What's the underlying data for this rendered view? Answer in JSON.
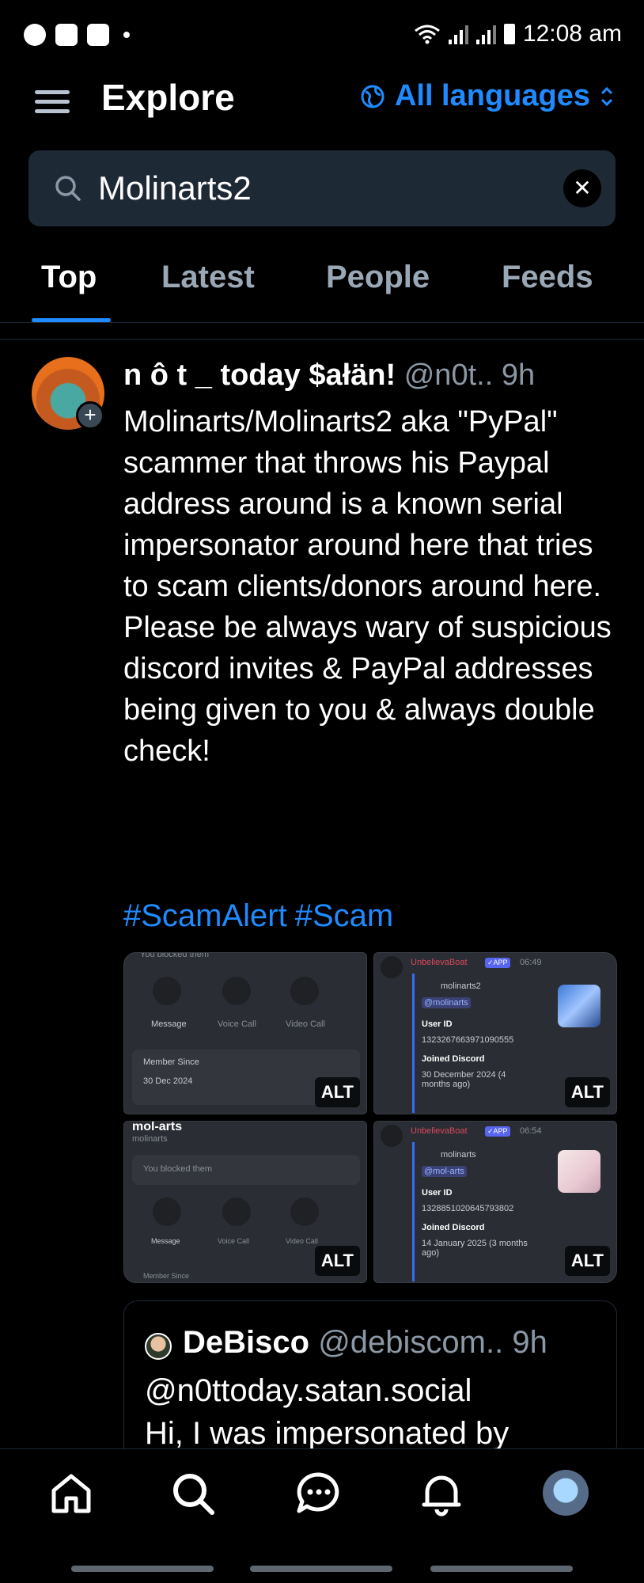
{
  "status_bar": {
    "time": "12:08 am",
    "icons": [
      "messenger-icon",
      "gallery-icon",
      "discord-icon",
      "dot-icon",
      "wifi-icon",
      "signal-icon",
      "signal-icon",
      "battery-icon"
    ]
  },
  "header": {
    "title": "Explore",
    "language": "All languages"
  },
  "search": {
    "value": "Molinarts2"
  },
  "tabs": [
    "Top",
    "Latest",
    "People",
    "Feeds"
  ],
  "active_tab": "Top",
  "post": {
    "display_name": "n ô t _ today $ałän!",
    "handle": "@n0t..",
    "time": "9h",
    "body": "Molinarts/Molinarts2 aka \"PyPal\" scammer that throws his Paypal address around is a known serial impersonator around here that tries to scam clients/donors around here. Please be always wary of suspicious discord invites & PayPal addresses being given to you & always double check!",
    "hashtags": [
      "#ScamAlert",
      "#Scam"
    ],
    "images": [
      {
        "alt_label": "ALT",
        "top_text": "You blocked them",
        "actions": [
          "Message",
          "Voice Call",
          "Video Call"
        ],
        "member_since_label": "Member Since",
        "member_since_value": "30 Dec 2024"
      },
      {
        "alt_label": "ALT",
        "bot_name": "UnbelievaBoat",
        "app_badge": "✓APP",
        "time": "06:49",
        "username": "molinarts2",
        "mention": "@molinarts",
        "user_id_label": "User ID",
        "user_id": "1323267663971090555",
        "joined_label": "Joined Discord",
        "joined_value": "30 December 2024 (4 months ago)"
      },
      {
        "alt_label": "ALT",
        "title": "mol-arts",
        "subtitle": "molinarts",
        "blocked_text": "You blocked them",
        "actions": [
          "Message",
          "Voice Call",
          "Video Call"
        ],
        "member_since_label": "Member Since"
      },
      {
        "alt_label": "ALT",
        "bot_name": "UnbelievaBoat",
        "app_badge": "✓APP",
        "time": "06:54",
        "username": "molinarts",
        "mention": "@mol-arts",
        "user_id_label": "User ID",
        "user_id": "1328851020645793802",
        "joined_label": "Joined Discord",
        "joined_value": "14 January 2025 (3 months ago)"
      }
    ]
  },
  "quoted_post": {
    "display_name": "DeBisco",
    "handle": "@debiscom..",
    "time": "9h",
    "body": "@n0ttoday.satan.social\nHi, I was impersonated by"
  },
  "bottom_nav": [
    "home-icon",
    "search-icon",
    "chat-icon",
    "bell-icon",
    "profile-avatar"
  ],
  "colors": {
    "accent": "#208bfe",
    "background": "#000000",
    "search_bg": "#1e2936",
    "muted_text": "#8b98a5"
  }
}
